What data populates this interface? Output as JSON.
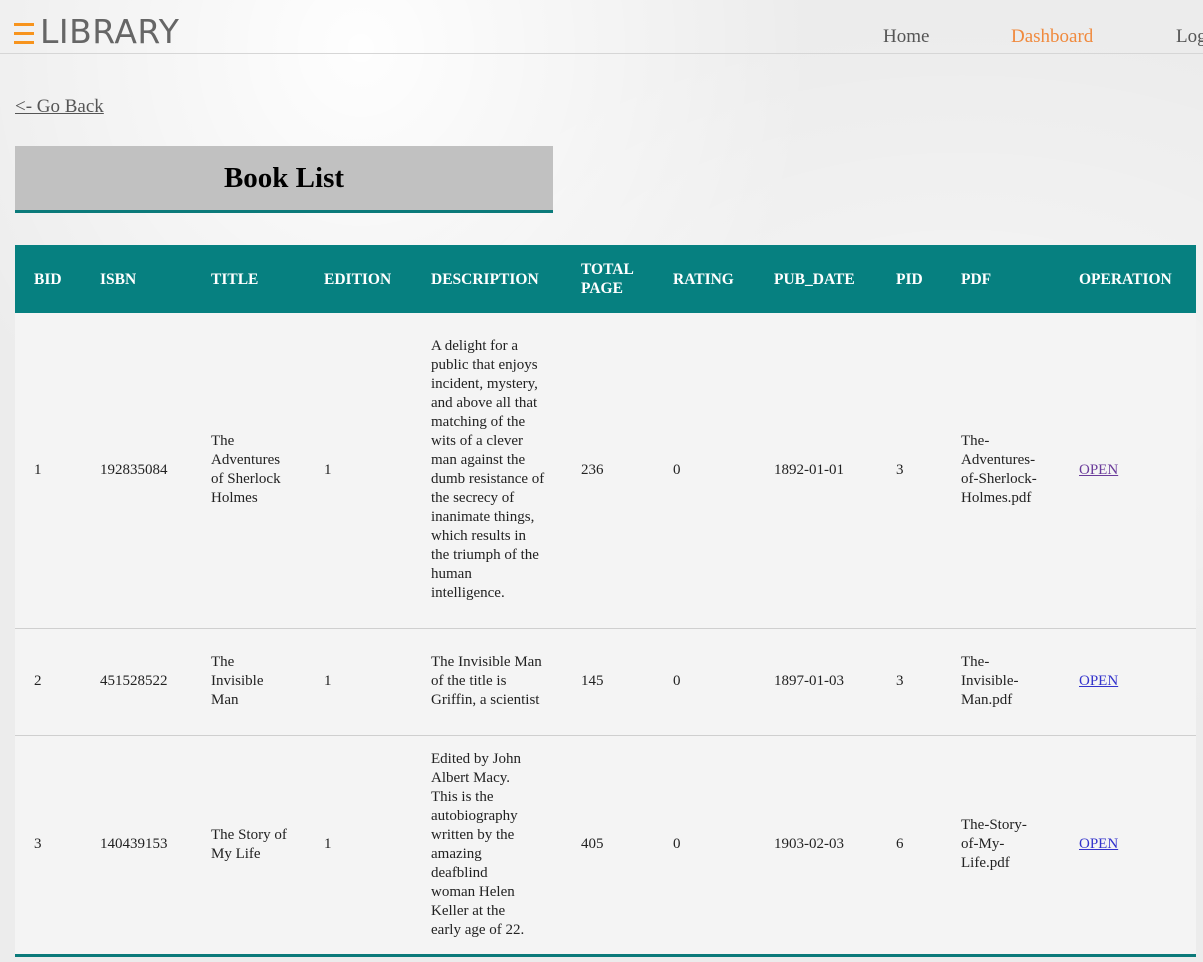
{
  "header": {
    "logo_text": "LIBRARY",
    "logo_icon": "hamburger-menu-icon",
    "nav": [
      {
        "label": "Home",
        "active": false
      },
      {
        "label": "Dashboard",
        "active": true
      },
      {
        "label": "Log",
        "active": false
      }
    ],
    "accent_color": "#f08a3e"
  },
  "go_back": "<- Go Back",
  "page_title": "Book List",
  "table": {
    "columns": [
      "BID",
      "ISBN",
      "TITLE",
      "EDITION",
      "DESCRIPTION",
      "TOTAL PAGE",
      "RATING",
      "PUB_DATE",
      "PID",
      "PDF",
      "OPERATION"
    ],
    "header_color": "#068080",
    "rows": [
      {
        "bid": "1",
        "isbn": "192835084",
        "title": "The Adventures of Sherlock Holmes",
        "edition": "1",
        "description": "A delight for a public that enjoys incident, mystery, and above all that matching of the wits of a clever man against the dumb resistance of the secrecy of inanimate things, which results in the triumph of the human intelligence.",
        "total_page": "236",
        "rating": "0",
        "pub_date": "1892-01-01",
        "pid": "3",
        "pdf": "The-Adventures-of-Sherlock-Holmes.pdf",
        "operation": "OPEN"
      },
      {
        "bid": "2",
        "isbn": "451528522",
        "title": "The Invisible Man",
        "edition": "1",
        "description": "The Invisible Man of the title is Griffin, a scientist",
        "total_page": "145",
        "rating": "0",
        "pub_date": "1897-01-03",
        "pid": "3",
        "pdf": "The-Invisible-Man.pdf",
        "operation": "OPEN"
      },
      {
        "bid": "3",
        "isbn": "140439153",
        "title": "The Story of My Life",
        "edition": "1",
        "description": "Edited by John Albert Macy. This is the autobiography written by the amazing deafblind woman Helen Keller at the early age of 22.",
        "total_page": "405",
        "rating": "0",
        "pub_date": "1903-02-03",
        "pid": "6",
        "pdf": "The-Story-of-My-Life.pdf",
        "operation": "OPEN"
      }
    ]
  }
}
